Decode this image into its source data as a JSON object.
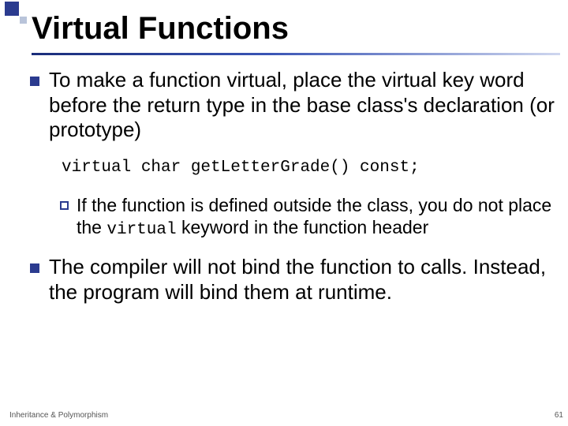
{
  "slide": {
    "title": "Virtual Functions",
    "bullet1": "To make a function virtual, place the virtual key word before the return type in the base class's declaration (or prototype)",
    "code": "virtual char getLetterGrade() const;",
    "sub1_prefix": "If the function is defined outside the class, you do not place the ",
    "sub1_code": "virtual",
    "sub1_suffix": " keyword in the function header",
    "bullet2": "The compiler will not bind the function to calls. Instead, the program will bind them at runtime.",
    "footer_left": "Inheritance & Polymorphism",
    "page_number": "61"
  }
}
